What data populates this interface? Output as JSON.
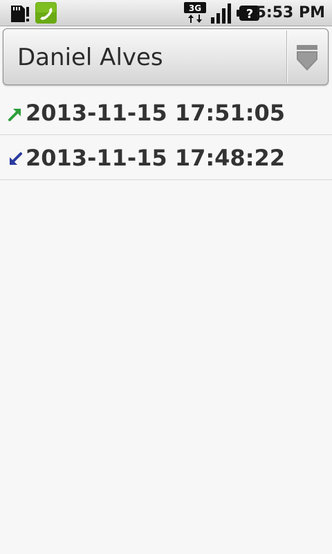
{
  "status_bar": {
    "time": "5:53 PM",
    "icons": [
      "sd-card-icon",
      "active-call-icon",
      "3g-network-icon",
      "signal-strength-icon",
      "battery-unknown-icon"
    ],
    "network_label": "3G",
    "battery_glyph": "?",
    "colors": {
      "call_icon_bg": "#6aaa14"
    }
  },
  "contact_spinner": {
    "selected": "Daniel Alves",
    "icon": "dropdown-arrow-icon"
  },
  "call_log": [
    {
      "direction": "outgoing",
      "icon": "outgoing-call-icon",
      "icon_color": "#2e9e3a",
      "timestamp": "2013-11-15 17:51:05"
    },
    {
      "direction": "incoming",
      "icon": "incoming-call-icon",
      "icon_color": "#2a3a9e",
      "timestamp": "2013-11-15 17:48:22"
    }
  ]
}
